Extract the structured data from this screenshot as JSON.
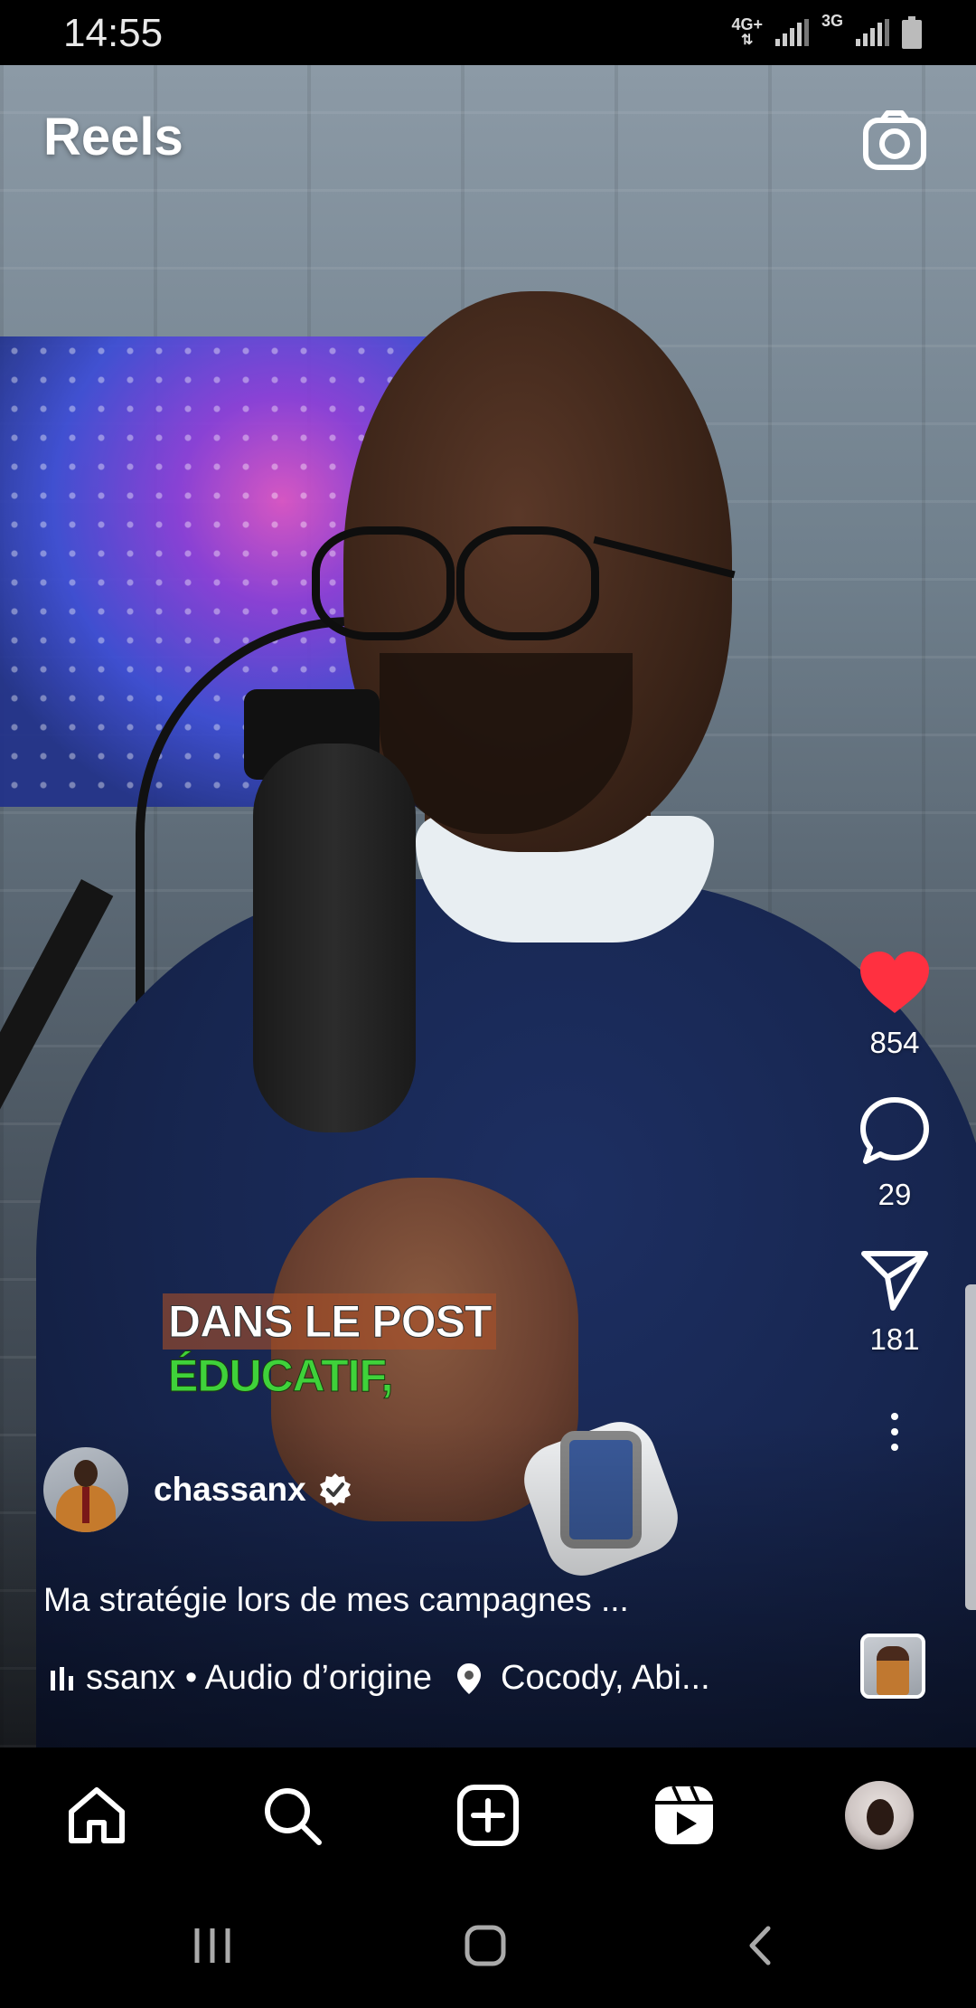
{
  "status_bar": {
    "time": "14:55",
    "network1": "4G+",
    "network2": "3G"
  },
  "header": {
    "title": "Reels",
    "camera_icon": "camera-icon"
  },
  "video": {
    "caption_line1": "DANS LE POST",
    "caption_line2": "ÉDUCATIF,"
  },
  "actions": {
    "likes": "854",
    "comments": "29",
    "shares": "181",
    "like_color": "#ff3040"
  },
  "post": {
    "username": "chassanx",
    "verified": true,
    "description": "Ma stratégie lors de mes campagnes ...",
    "audio": "ssanx • Audio d’origine",
    "location": "Cocody, Abi..."
  },
  "bottom_nav": {
    "items": [
      "home-icon",
      "search-icon",
      "create-icon",
      "reels-icon",
      "profile-avatar"
    ]
  },
  "system_nav": {
    "items": [
      "recent-apps-icon",
      "home-button-icon",
      "back-icon"
    ]
  }
}
